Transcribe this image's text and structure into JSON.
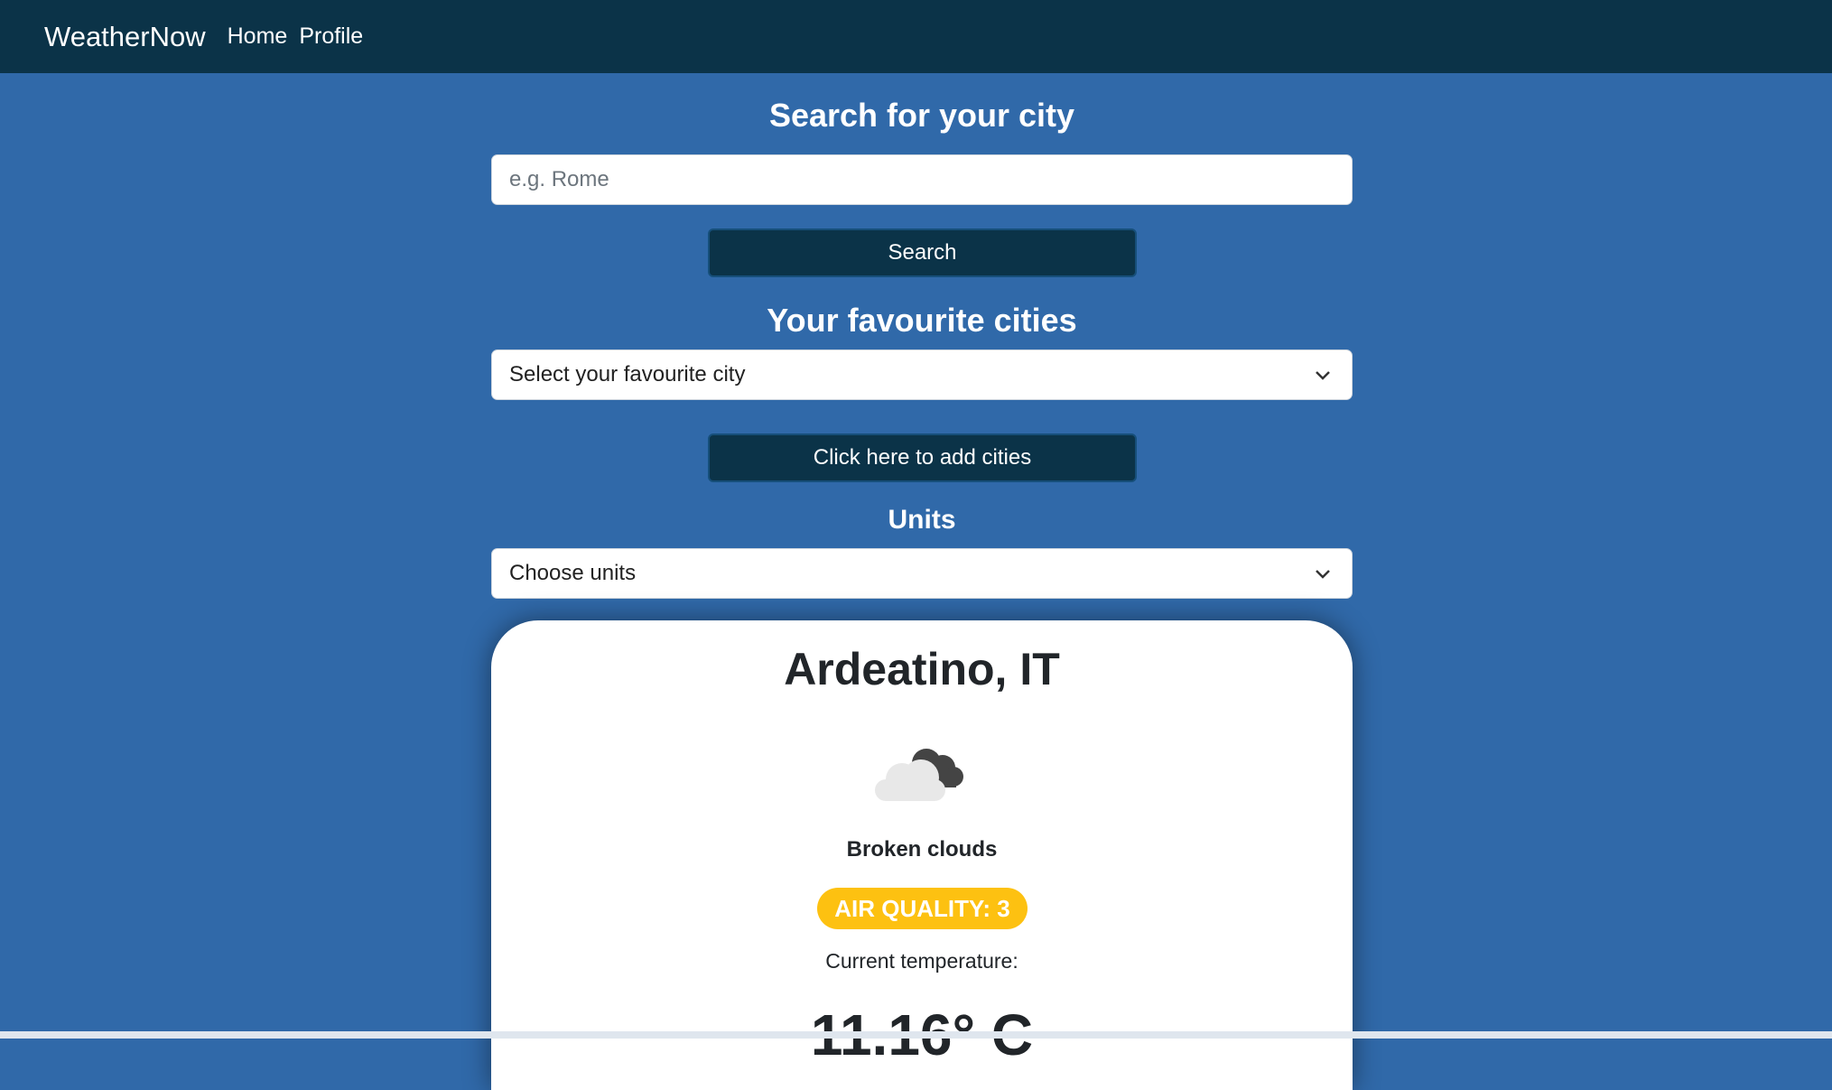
{
  "nav": {
    "brand": "WeatherNow",
    "links": [
      "Home",
      "Profile"
    ]
  },
  "search": {
    "heading": "Search for your city",
    "placeholder": "e.g. Rome",
    "button_label": "Search"
  },
  "favourites": {
    "heading": "Your favourite cities",
    "select_value": "Select your favourite city",
    "add_button_label": "Click here to add cities"
  },
  "units": {
    "heading": "Units",
    "select_value": "Choose units"
  },
  "weather": {
    "city": "Ardeatino, IT",
    "icon": "broken-clouds-icon",
    "description": "Broken clouds",
    "air_quality": "AIR QUALITY: 3",
    "temp_label": "Current temperature:",
    "temperature": "11.16° C"
  },
  "colors": {
    "background": "#3069a9",
    "navbar": "#0b3348",
    "air_quality_badge": "#fdc111"
  }
}
